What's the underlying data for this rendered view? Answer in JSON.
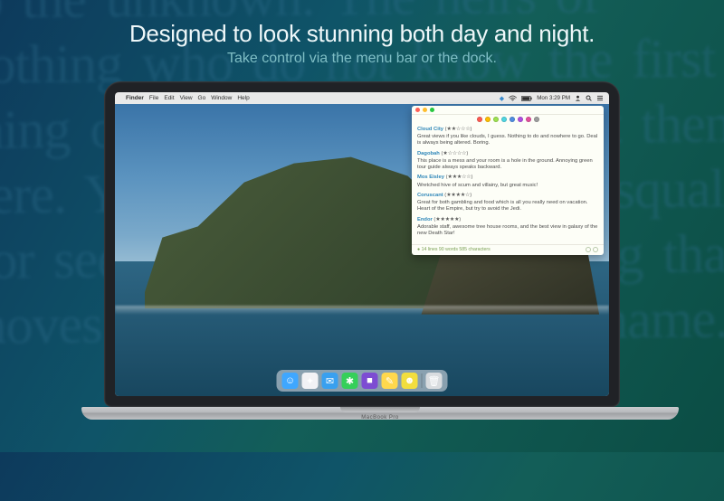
{
  "promo": {
    "headline": "Designed to look stunning both day and night.",
    "subhead": "Take control via the menu bar or the dock."
  },
  "laptop": {
    "model_label": "MacBook Pro"
  },
  "menubar": {
    "apple": "",
    "app": "Finder",
    "items": [
      "File",
      "Edit",
      "View",
      "Go",
      "Window",
      "Help"
    ],
    "clock": "Mon 3:29 PM"
  },
  "panel": {
    "color_dots": [
      "#ff5a52",
      "#ffbe00",
      "#9de24f",
      "#4fd6e2",
      "#4f8de2",
      "#b04fe2",
      "#e24f9e",
      "#9e9e9e"
    ],
    "entries": [
      {
        "title": "Cloud City",
        "stars": "(★★☆☆☆)",
        "desc": "Great views if you like clouds, I guess. Nothing to do and nowhere to go. Deal is always being altered. Boring."
      },
      {
        "title": "Dagobah",
        "stars": "(★☆☆☆☆)",
        "desc": "This place is a mess and your room is a hole in the ground. Annoying green tour guide always speaks backward."
      },
      {
        "title": "Mos Eisley",
        "stars": "(★★★☆☆)",
        "desc": "Wretched hive of scum and villainy, but great music!"
      },
      {
        "title": "Coruscant",
        "stars": "(★★★★☆)",
        "desc": "Great for both gambling and food which is all you really need on vacation. Heart of the Empire, but try to avoid the Jedi."
      },
      {
        "title": "Endor",
        "stars": "(★★★★★)",
        "desc": "Adorable staff, awesome tree house rooms, and the best view in galaxy of the new Death Star!"
      }
    ],
    "footer": {
      "stats": "● 14 lines   90 words   585 characters"
    }
  },
  "dock": {
    "items": [
      {
        "name": "finder",
        "bg": "#3fa7ff",
        "glyph": "☺"
      },
      {
        "name": "safari",
        "bg": "#f2f2f5",
        "glyph": "✦"
      },
      {
        "name": "mail",
        "bg": "#39a0ef",
        "glyph": "✉"
      },
      {
        "name": "messages",
        "bg": "#35cf5a",
        "glyph": "✱"
      },
      {
        "name": "app1",
        "bg": "#7d4dd2",
        "glyph": "■"
      },
      {
        "name": "notes",
        "bg": "#ffd84d",
        "glyph": "✎"
      },
      {
        "name": "app2",
        "bg": "#f2de3e",
        "glyph": "☻"
      },
      {
        "name": "trash",
        "bg": "#d9dcdf",
        "glyph": "🗑"
      }
    ]
  },
  "bg_filler": "to the unknown. The heirs of nothing who do not know the first thing of the story that brought them here. You have not heard the squall nor seen the shape of the thing that moves in the dark without a name."
}
